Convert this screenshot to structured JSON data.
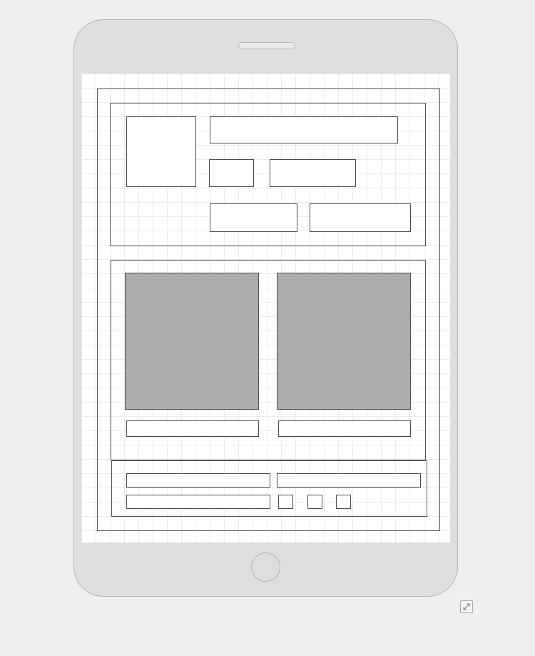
{
  "device": {
    "type": "tablet"
  },
  "wireframe": {
    "header_section": {
      "fields": []
    },
    "gallery_section": {
      "cards": [
        {
          "caption": ""
        },
        {
          "caption": ""
        }
      ]
    },
    "footer_section": {
      "fields": []
    }
  },
  "icons": {
    "expand": "expand-icon",
    "speaker": "speaker-slot",
    "home": "home-button"
  }
}
